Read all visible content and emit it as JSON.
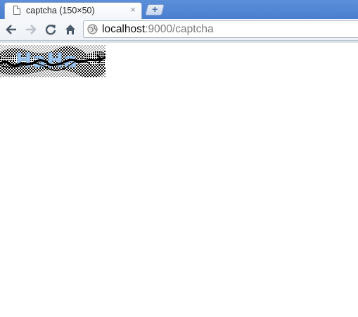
{
  "tab": {
    "title": "captcha (150×50)",
    "close_glyph": "×",
    "icon": "page-icon"
  },
  "new_tab": {
    "glyph": "+"
  },
  "toolbar": {
    "back_glyph": "←",
    "forward_glyph": "→",
    "reload_glyph": "C",
    "home_icon": "home-icon"
  },
  "omnibox": {
    "host": "localhost",
    "path": ":9000/captcha",
    "icon": "globe-icon"
  },
  "captcha": {
    "text": "HaHa",
    "colors": {
      "text": "#9cc4ec",
      "noise": "#000000",
      "background": "#ffffff"
    }
  }
}
